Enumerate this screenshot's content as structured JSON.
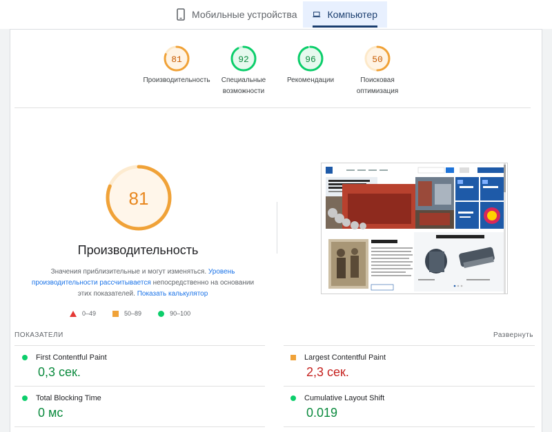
{
  "tabs": {
    "mobile": "Мобильные устройства",
    "desktop": "Компьютер"
  },
  "scores": [
    {
      "value": "81",
      "label_line1": "Производительность",
      "label_line2": "",
      "score": 81,
      "status": "average"
    },
    {
      "value": "92",
      "label_line1": "Специальные",
      "label_line2": "возможности",
      "score": 92,
      "status": "good"
    },
    {
      "value": "96",
      "label_line1": "Рекомендации",
      "label_line2": "",
      "score": 96,
      "status": "good"
    },
    {
      "value": "50",
      "label_line1": "Поисковая",
      "label_line2": "оптимизация",
      "score": 50,
      "status": "average"
    }
  ],
  "main_score": {
    "value": "81",
    "score": 81
  },
  "performance": {
    "title": "Производительность",
    "desc_1": "Значения приблизительные и могут изменяться.",
    "link_1": "Уровень производительности рассчитывается",
    "desc_2": "непосредственно на основании этих показателей.",
    "link_2": "Показать калькулятор"
  },
  "legend": {
    "bad": "0–49",
    "average": "50–89",
    "good": "90–100"
  },
  "metrics": {
    "header": "ПОКАЗАТЕЛИ",
    "expand": "Развернуть",
    "fcp": {
      "name": "First Contentful Paint",
      "value": "0,3 сек."
    },
    "lcp": {
      "name": "Largest Contentful Paint",
      "value": "2,3 сек."
    },
    "tbt": {
      "name": "Total Blocking Time",
      "value": "0 мс"
    },
    "cls": {
      "name": "Cumulative Layout Shift",
      "value": "0.019"
    }
  },
  "colors": {
    "good": "#0cce6b",
    "average": "#ffa400",
    "bad": "#ff4e42",
    "accent": "#1a73e8"
  },
  "screenshot": {
    "hero_text": "Тяговый вал, одновременно сочетающийся высокой производительностью",
    "section_about": "О компании",
    "section_new": "Последние разработки"
  }
}
